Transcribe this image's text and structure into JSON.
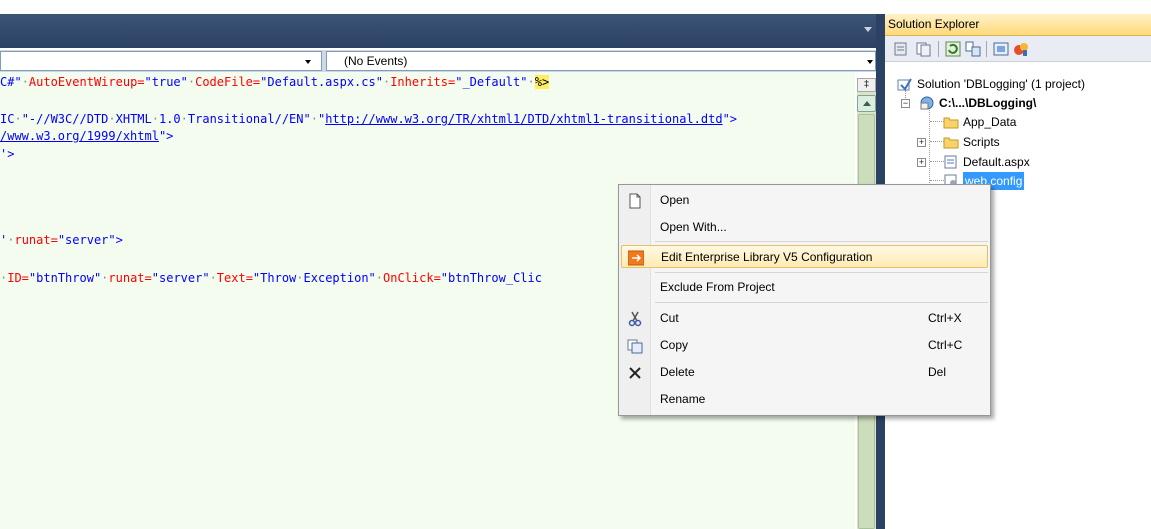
{
  "editor": {
    "nav": {
      "left_combo": "",
      "events_combo": "(No Events)"
    },
    "code": {
      "l1": {
        "a": "C#\"",
        "b": "AutoEventWireup=",
        "c": "\"true\"",
        "d": "CodeFile=",
        "e": "\"Default.aspx.cs\"",
        "f": "Inherits=",
        "g": "\"_Default\"",
        "h": "%>"
      },
      "l2": {
        "a": "IC",
        "b": "\"-//W3C//DTD",
        "c": "XHTML",
        "d": "1.0",
        "e": "Transitional//EN\"",
        "f": "\"",
        "g": "http://www.w3.org/TR/xhtml1/DTD/xhtml1-transitional.dtd",
        "h": "\">"
      },
      "l3": {
        "a": "/www.w3.org/1999/xhtml",
        "b": "\">"
      },
      "l4": {
        "a": "'>"
      },
      "l5": {
        "a": "'",
        "b": "runat=",
        "c": "\"server\">"
      },
      "l6": {
        "a": "ID=",
        "b": "\"btnThrow\"",
        "c": "runat=",
        "d": "\"server\"",
        "e": "Text=",
        "f": "\"Throw",
        "g": "Exception\"",
        "h": "OnClick=",
        "i": "\"btnThrow_Clic"
      }
    },
    "split_glyph": "‡"
  },
  "solution_explorer": {
    "title": "Solution Explorer",
    "tree": {
      "solution": "Solution 'DBLogging' (1 project)",
      "project": "C:\\...\\DBLogging\\",
      "app_data": "App_Data",
      "scripts": "Scripts",
      "default_aspx": "Default.aspx",
      "web_config": "web.config"
    }
  },
  "context_menu": {
    "open": "Open",
    "open_with": "Open With...",
    "edit_config": "Edit Enterprise Library V5 Configuration",
    "exclude": "Exclude From Project",
    "cut": "Cut",
    "cut_shortcut": "Ctrl+X",
    "copy": "Copy",
    "copy_shortcut": "Ctrl+C",
    "delete": "Delete",
    "delete_shortcut": "Del",
    "rename": "Rename",
    "highlighted_item": "Edit Enterprise Library V5 Configuration"
  },
  "colors": {
    "code_background": "#f3fcef",
    "attribute": "#ff0000",
    "value": "#0000ff",
    "selection": "#3399ff",
    "header_dark": "#2c4264"
  },
  "icons": [
    "refresh-icon",
    "properties-icon",
    "show-all-files-icon",
    "view-code-icon",
    "view-designer-icon",
    "copy-website-icon",
    "asp-config-icon",
    "open-icon",
    "edit-config-icon",
    "cut-icon",
    "copy-icon",
    "delete-icon",
    "solution-icon",
    "project-icon",
    "folder-icon",
    "aspx-file-icon",
    "config-file-icon"
  ]
}
